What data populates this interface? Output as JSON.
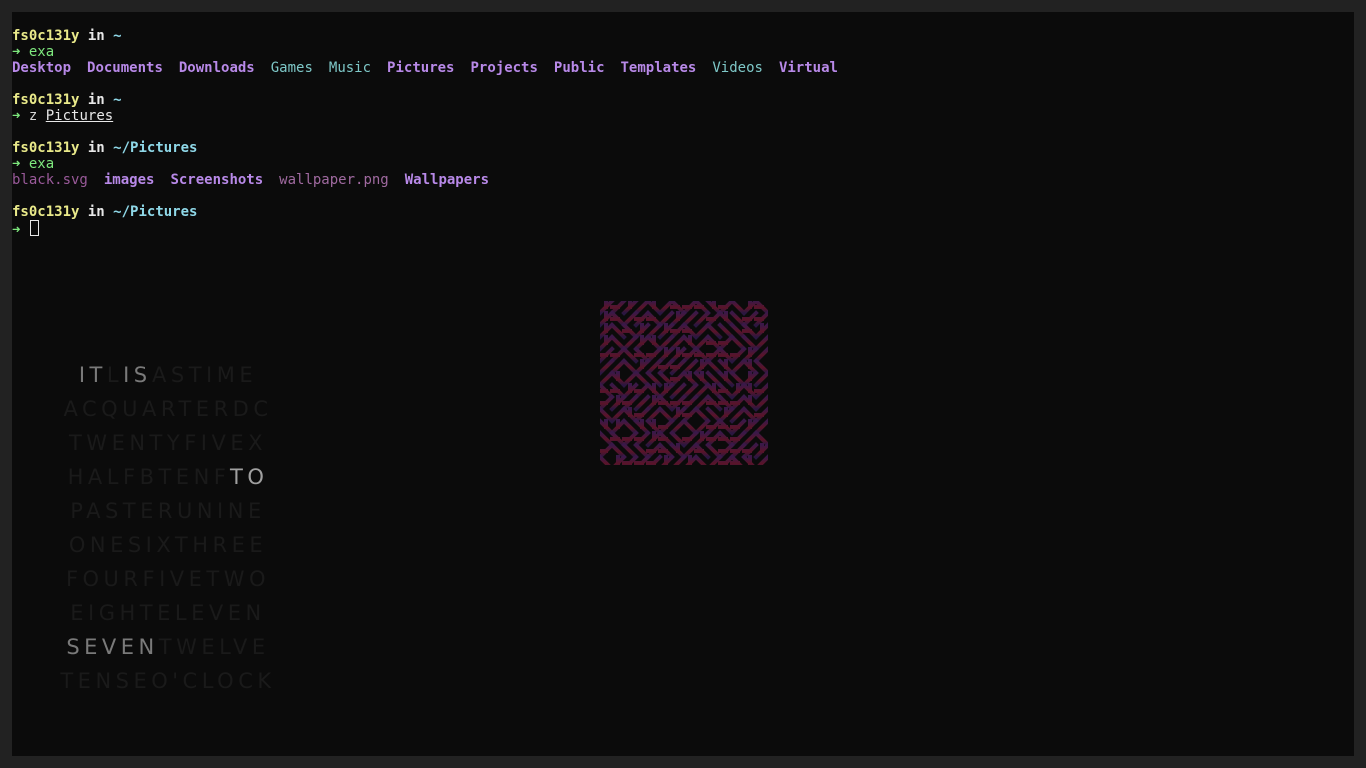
{
  "terminal": {
    "prompts": [
      {
        "user": "fs0c131y",
        "in": "in",
        "path": "~",
        "arrow": "➜",
        "command": "exa",
        "argument": ""
      },
      {
        "user": "fs0c131y",
        "in": "in",
        "path": "~",
        "arrow": "➜",
        "command": "z",
        "argument": "Pictures"
      },
      {
        "user": "fs0c131y",
        "in": "in",
        "path": "~/Pictures",
        "arrow": "➜",
        "command": "exa",
        "argument": ""
      },
      {
        "user": "fs0c131y",
        "in": "in",
        "path": "~/Pictures",
        "arrow": "➜",
        "command": "",
        "argument": ""
      }
    ],
    "home_listing": [
      {
        "name": "Desktop",
        "kind": "dir"
      },
      {
        "name": "Documents",
        "kind": "dir"
      },
      {
        "name": "Downloads",
        "kind": "dir"
      },
      {
        "name": "Games",
        "kind": "link"
      },
      {
        "name": "Music",
        "kind": "link"
      },
      {
        "name": "Pictures",
        "kind": "dir"
      },
      {
        "name": "Projects",
        "kind": "dir"
      },
      {
        "name": "Public",
        "kind": "dir"
      },
      {
        "name": "Templates",
        "kind": "dir"
      },
      {
        "name": "Videos",
        "kind": "link"
      },
      {
        "name": "Virtual",
        "kind": "dir"
      }
    ],
    "pictures_listing": [
      {
        "name": "black.svg",
        "kind": "file-svg"
      },
      {
        "name": "images",
        "kind": "dir"
      },
      {
        "name": "Screenshots",
        "kind": "dir"
      },
      {
        "name": "wallpaper.png",
        "kind": "file-png"
      },
      {
        "name": "Wallpapers",
        "kind": "dir"
      }
    ]
  },
  "word_clock": {
    "rows": [
      [
        "IT",
        "L",
        "IS",
        "ASTIME"
      ],
      [
        "ACQUARTERDC"
      ],
      [
        "TWENTYFIVEX"
      ],
      [
        "HALFBTENF",
        "TO"
      ],
      [
        "PASTERUNINE"
      ],
      [
        "ONESIXTHREE"
      ],
      [
        "FOURFIVETWO"
      ],
      [
        "EIGHTELEVEN"
      ],
      [
        "SEVEN",
        "TWELVE"
      ],
      [
        "TENSEO'CLOCK"
      ]
    ],
    "lit": {
      "0": [
        0,
        2
      ],
      "3": [
        1
      ],
      "8": [
        0
      ]
    }
  },
  "colors": {
    "background": "#0b0b0b",
    "frame": "#222222",
    "user": "#eaea8a",
    "path": "#8fd8e8",
    "prompt_arrow": "#7ee87e",
    "directory": "#b889e8",
    "link": "#7ec8c8",
    "logo_purple": "#3a1848",
    "logo_red": "#5a1428"
  },
  "icons": {
    "logo": "maze-pattern-logo"
  }
}
